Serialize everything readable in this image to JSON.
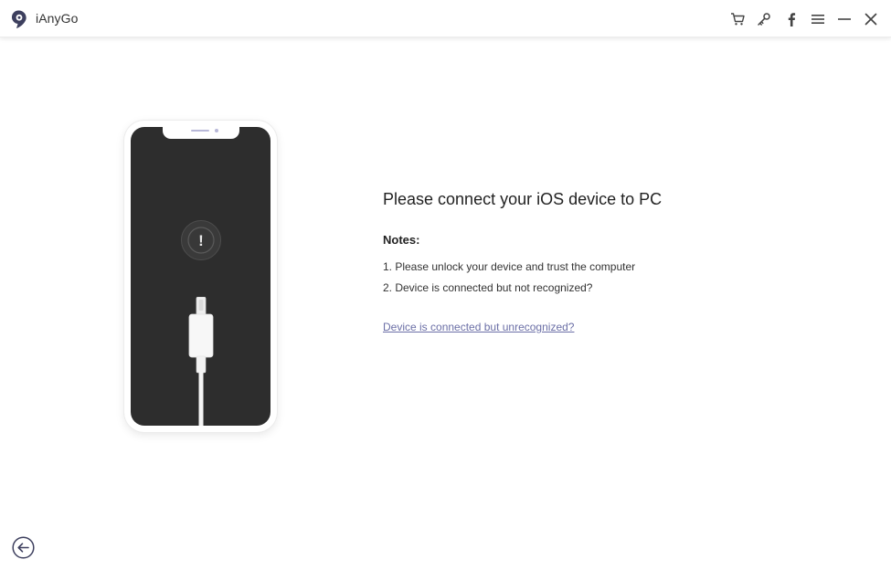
{
  "app": {
    "title": "iAnyGo",
    "icons": [
      "app-logo-icon",
      "cart-icon",
      "key-icon",
      "facebook-icon",
      "menu-icon",
      "minimize-icon",
      "close-icon"
    ]
  },
  "content": {
    "heading": "Please connect your iOS device to PC",
    "notes_label": "Notes:",
    "notes": [
      "1. Please unlock your device and trust the computer",
      "2. Device is connected but not recognized?"
    ],
    "help_link": "Device is connected but unrecognized?"
  },
  "illustration": {
    "icons": [
      "phone-illustration",
      "alert-icon",
      "lightning-cable-icon"
    ],
    "alert_glyph": "!"
  },
  "footer": {
    "icons": [
      "back-arrow-icon"
    ]
  },
  "colors": {
    "accent": "#6b6fa6",
    "phone_screen": "#2d2d2d",
    "logo": "#3d3f5e"
  }
}
